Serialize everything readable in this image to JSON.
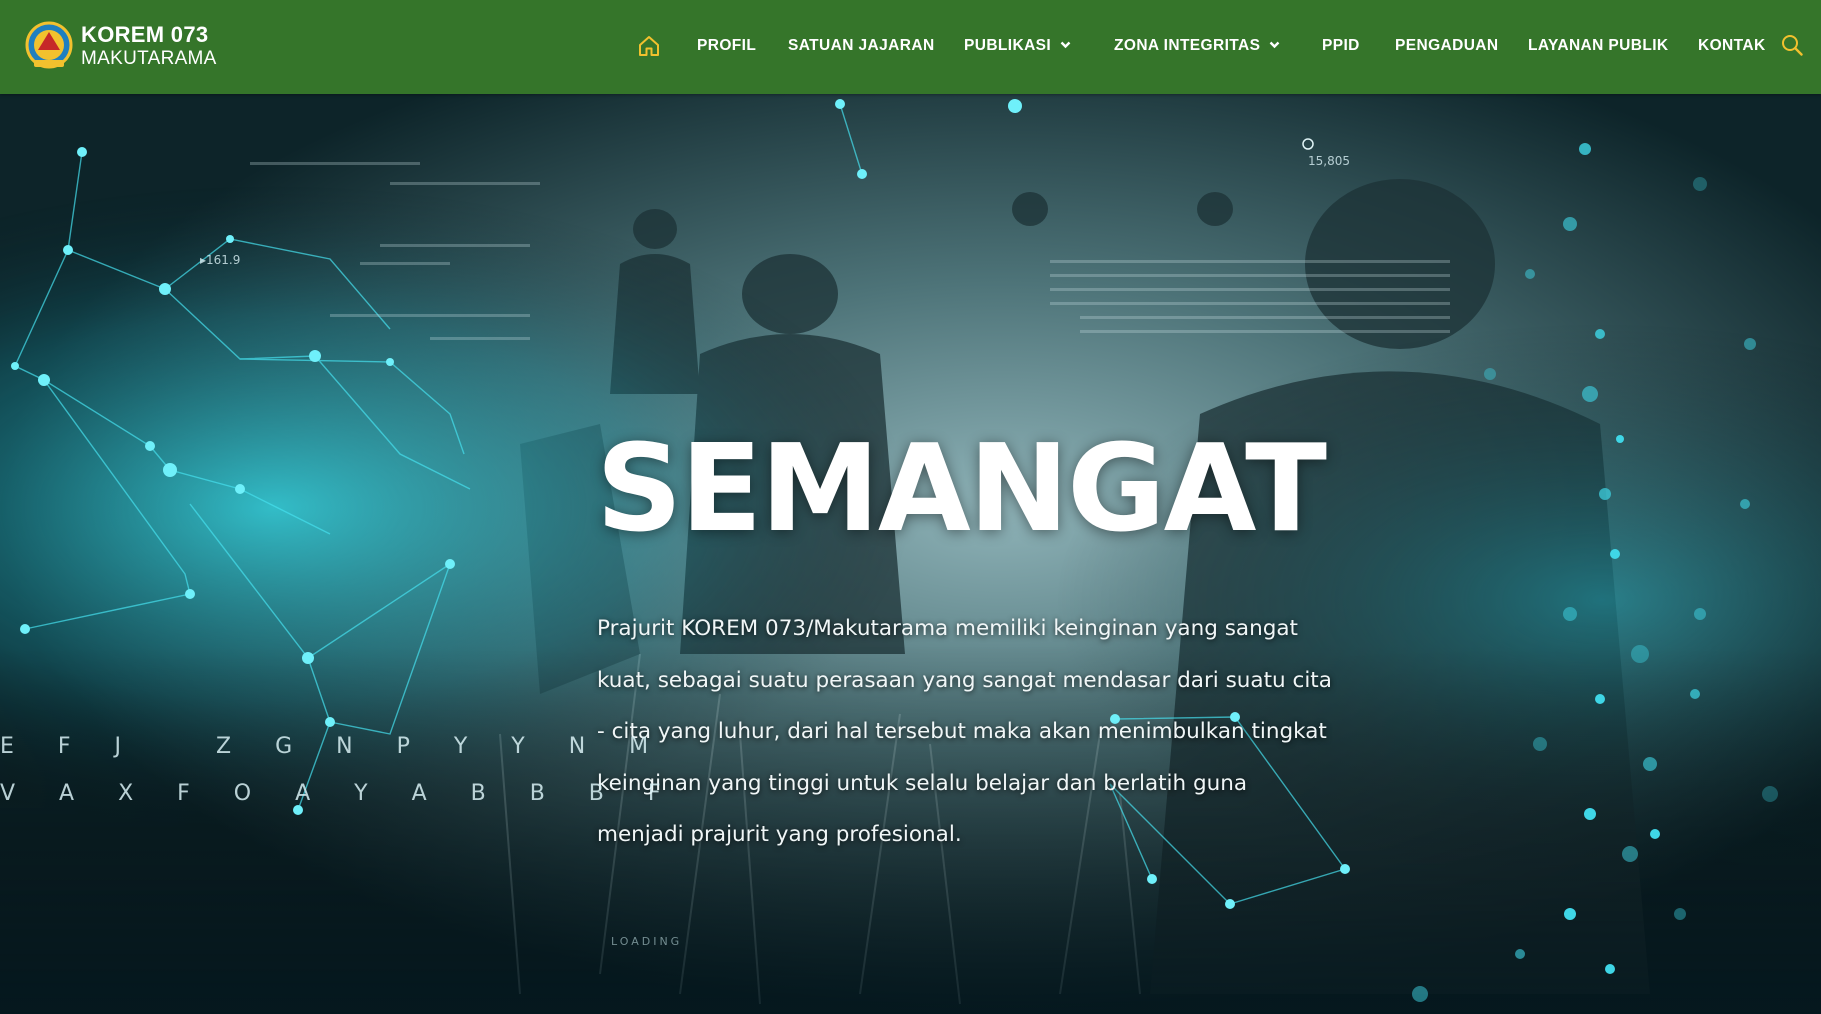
{
  "brand": {
    "title": "KOREM 073",
    "subtitle": "MAKUTARAMA",
    "emblem_icon": "korem-emblem-icon"
  },
  "nav": {
    "home_icon": "home-icon",
    "items": [
      {
        "label": "PROFIL",
        "dropdown": false
      },
      {
        "label": "SATUAN JAJARAN",
        "dropdown": false
      },
      {
        "label": "PUBLIKASI",
        "dropdown": true
      },
      {
        "label": "ZONA INTEGRITAS",
        "dropdown": true
      },
      {
        "label": "PPID",
        "dropdown": false
      },
      {
        "label": "PENGADUAN",
        "dropdown": false
      },
      {
        "label": "LAYANAN PUBLIK",
        "dropdown": false
      },
      {
        "label": "KONTAK",
        "dropdown": false
      }
    ],
    "search_icon": "search-icon"
  },
  "hero": {
    "title": "SEMANGAT",
    "description": "Prajurit KOREM 073/Makutarama memiliki keinginan yang sangat kuat, sebagai suatu perasaan yang sangat mendasar dari suatu cita - cita yang luhur, dari hal tersebut maka akan menimbulkan tingkat keinginan yang tinggi untuk selalu belajar dan berlatih guna menjadi prajurit yang profesional.",
    "code_row_1": "E F J   Z G N P Y Y N M",
    "code_row_2": "V A X F O A Y A B B B F",
    "readout_left": "▸161.9",
    "readout_right": "15,805",
    "loading": "LOADING"
  },
  "colors": {
    "navbar": "#35752a",
    "accent_icon": "#f2c12e",
    "hero_glow": "#2fd0e0"
  }
}
